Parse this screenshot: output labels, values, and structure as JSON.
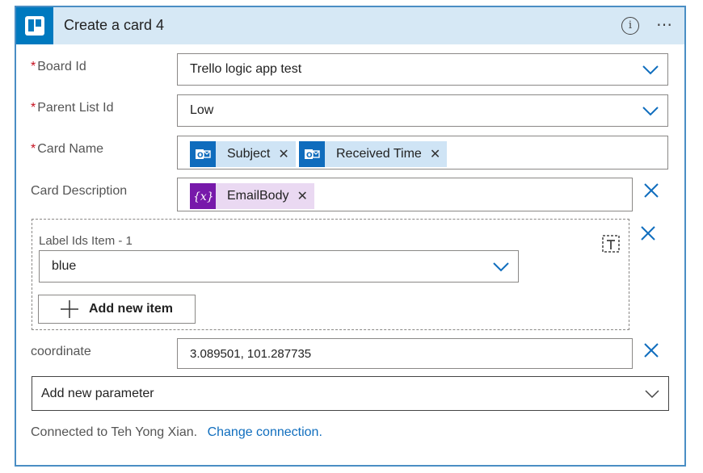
{
  "header": {
    "title": "Create a card 4",
    "info_glyph": "i",
    "more_glyph": "⋯",
    "logo_icon": "trello-icon"
  },
  "fields": {
    "board_id": {
      "label": "Board Id",
      "required_mark": "*",
      "value": "Trello logic app test"
    },
    "parent_list_id": {
      "label": "Parent List Id",
      "required_mark": "*",
      "value": "Low"
    },
    "card_name": {
      "label": "Card Name",
      "required_mark": "*",
      "tokens": [
        {
          "label": "Subject",
          "icon": "outlook-icon",
          "color": "#0f6cbd",
          "bg": "#cfe4f5"
        },
        {
          "label": "Received Time",
          "icon": "outlook-icon",
          "color": "#0f6cbd",
          "bg": "#cfe4f5"
        }
      ]
    },
    "card_description": {
      "label": "Card Description",
      "tokens": [
        {
          "label": "EmailBody",
          "icon": "variable-icon",
          "color": "#7719aa",
          "bg": "#ead9f2"
        }
      ]
    },
    "label_ids": {
      "item_label": "Label Ids Item - 1",
      "value": "blue",
      "add_button": "Add new item",
      "toggle_icon": "text-mode-icon"
    },
    "coordinate": {
      "label": "coordinate",
      "value": "3.089501, 101.287735"
    }
  },
  "add_parameter": {
    "placeholder": "Add new parameter"
  },
  "connection": {
    "text": "Connected to Teh Yong Xian.",
    "link": "Change connection."
  },
  "colors": {
    "accent": "#0079bf",
    "header_bg": "#d6e8f5",
    "border": "#4a8ec4",
    "remove_x": "#106ebe"
  }
}
